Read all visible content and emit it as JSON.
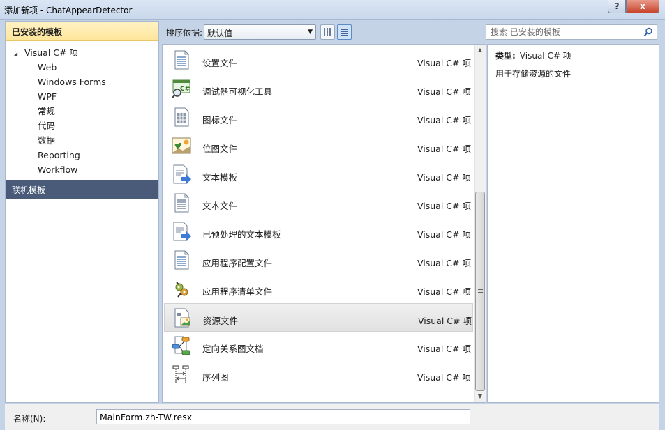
{
  "window": {
    "title": "添加新项 - ChatAppearDetector",
    "help_icon": "?",
    "close_icon": "x"
  },
  "left": {
    "installed_header": "已安装的模板",
    "tree_root": "Visual C# 项",
    "tree_children": [
      "Web",
      "Windows Forms",
      "WPF",
      "常规",
      "代码",
      "数据",
      "Reporting",
      "Workflow"
    ],
    "online_header": "联机模板"
  },
  "toolbar": {
    "sort_label": "排序依据:",
    "sort_value": "默认值",
    "search_placeholder": "搜索 已安装的模板"
  },
  "items": [
    {
      "name": "设置文件",
      "type": "Visual C# 项",
      "icon": "settings-file-icon"
    },
    {
      "name": "调试器可视化工具",
      "type": "Visual C# 项",
      "icon": "debugger-visualizer-icon"
    },
    {
      "name": "图标文件",
      "type": "Visual C# 项",
      "icon": "icon-file-icon"
    },
    {
      "name": "位图文件",
      "type": "Visual C# 项",
      "icon": "bitmap-file-icon"
    },
    {
      "name": "文本模板",
      "type": "Visual C# 项",
      "icon": "text-template-icon"
    },
    {
      "name": "文本文件",
      "type": "Visual C# 项",
      "icon": "text-file-icon"
    },
    {
      "name": "已预处理的文本模板",
      "type": "Visual C# 项",
      "icon": "preprocessed-template-icon"
    },
    {
      "name": "应用程序配置文件",
      "type": "Visual C# 项",
      "icon": "app-config-icon"
    },
    {
      "name": "应用程序清单文件",
      "type": "Visual C# 项",
      "icon": "app-manifest-icon"
    },
    {
      "name": "资源文件",
      "type": "Visual C# 项",
      "icon": "resource-file-icon",
      "selected": true
    },
    {
      "name": "定向关系图文档",
      "type": "Visual C# 项",
      "icon": "dgml-icon"
    },
    {
      "name": "序列图",
      "type": "Visual C# 项",
      "icon": "sequence-diagram-icon"
    }
  ],
  "details": {
    "type_label": "类型:",
    "type_value": "Visual C# 项",
    "description": "用于存储资源的文件"
  },
  "bottom": {
    "name_label": "名称(N):",
    "name_value": "MainForm.zh-TW.resx"
  }
}
